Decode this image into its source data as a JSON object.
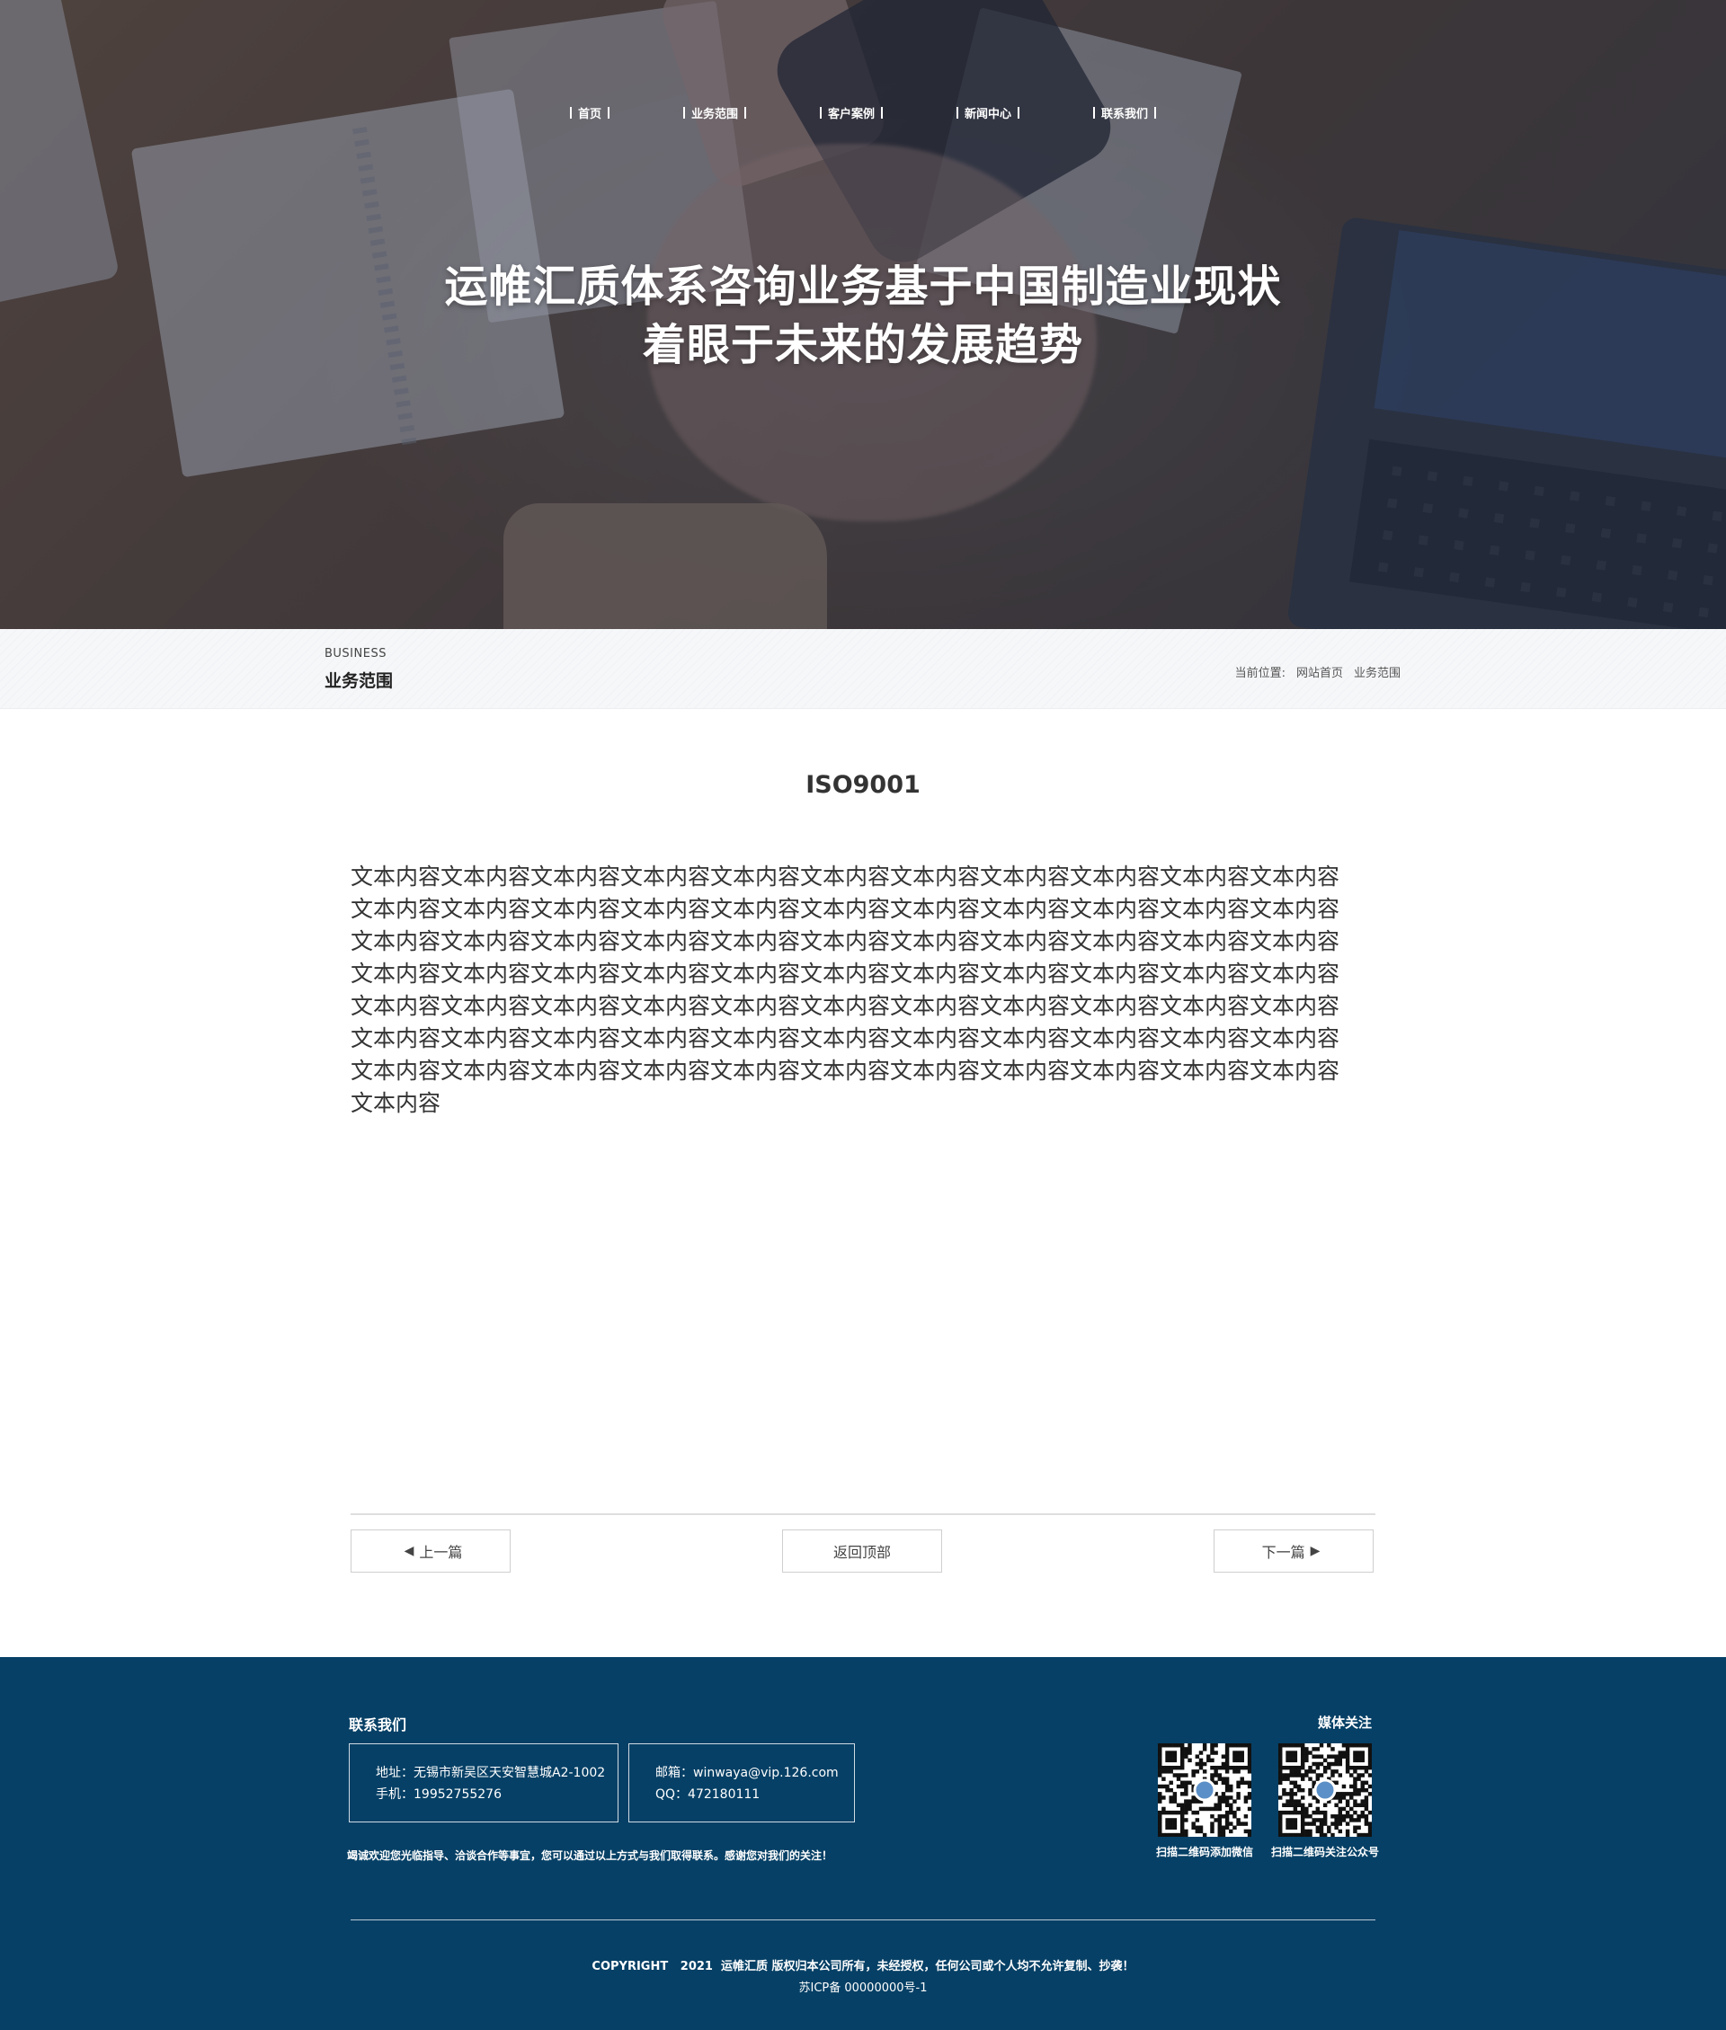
{
  "nav": {
    "items": [
      {
        "label": "首页"
      },
      {
        "label": "业务范围"
      },
      {
        "label": "客户案例"
      },
      {
        "label": "新闻中心"
      },
      {
        "label": "联系我们"
      }
    ]
  },
  "hero": {
    "title_line1": "运帷汇质体系咨询业务基于中国制造业现状",
    "title_line2": "着眼于未来的发展趋势"
  },
  "subbar": {
    "en_title": "BUSINESS",
    "cn_title": "业务范围",
    "breadcrumb_prefix": "当前位置:",
    "breadcrumb_home": "网站首页",
    "breadcrumb_current": "业务范围"
  },
  "article": {
    "title": "ISO9001",
    "body": "文本内容文本内容文本内容文本内容文本内容文本内容文本内容文本内容文本内容文本内容文本内容文本内容文本内容文本内容文本内容文本内容文本内容文本内容文本内容文本内容文本内容文本内容文本内容文本内容文本内容文本内容文本内容文本内容文本内容文本内容文本内容文本内容文本内容文本内容文本内容文本内容文本内容文本内容文本内容文本内容文本内容文本内容文本内容文本内容文本内容文本内容文本内容文本内容文本内容文本内容文本内容文本内容文本内容文本内容文本内容文本内容文本内容文本内容文本内容文本内容文本内容文本内容文本内容文本内容文本内容文本内容文本内容文本内容文本内容文本内容文本内容文本内容文本内容文本内容文本内容文本内容文本内容文本内容"
  },
  "pager": {
    "prev_label": "上一篇",
    "top_label": "返回顶部",
    "next_label": "下一篇"
  },
  "footer": {
    "contact_title": "联系我们",
    "address": "地址：无锡市新吴区天安智慧城A2-1002",
    "phone": "手机：19952755276",
    "email": "邮箱：winwaya@vip.126.com",
    "qq": "QQ：472180111",
    "note": "竭诚欢迎您光临指导、洽谈合作等事宜，您可以通过以上方式与我们取得联系。感谢您对我们的关注！",
    "media_title": "媒体关注",
    "qr1_caption": "扫描二维码添加微信",
    "qr2_caption": "扫描二维码关注公众号",
    "copyright": "COPYRIGHT   2021  运帷汇质 版权归本公司所有，未经授权，任何公司或个人均不允许复制、抄袭！",
    "icp": "苏ICP备 00000000号-1"
  },
  "colors": {
    "footer_bg": "#064066",
    "text": "#333333",
    "hero_overlay": "#232d46"
  },
  "icons": {
    "prev": "left-triangle-icon",
    "next": "right-triangle-icon",
    "qr": "qr-code-icon"
  }
}
